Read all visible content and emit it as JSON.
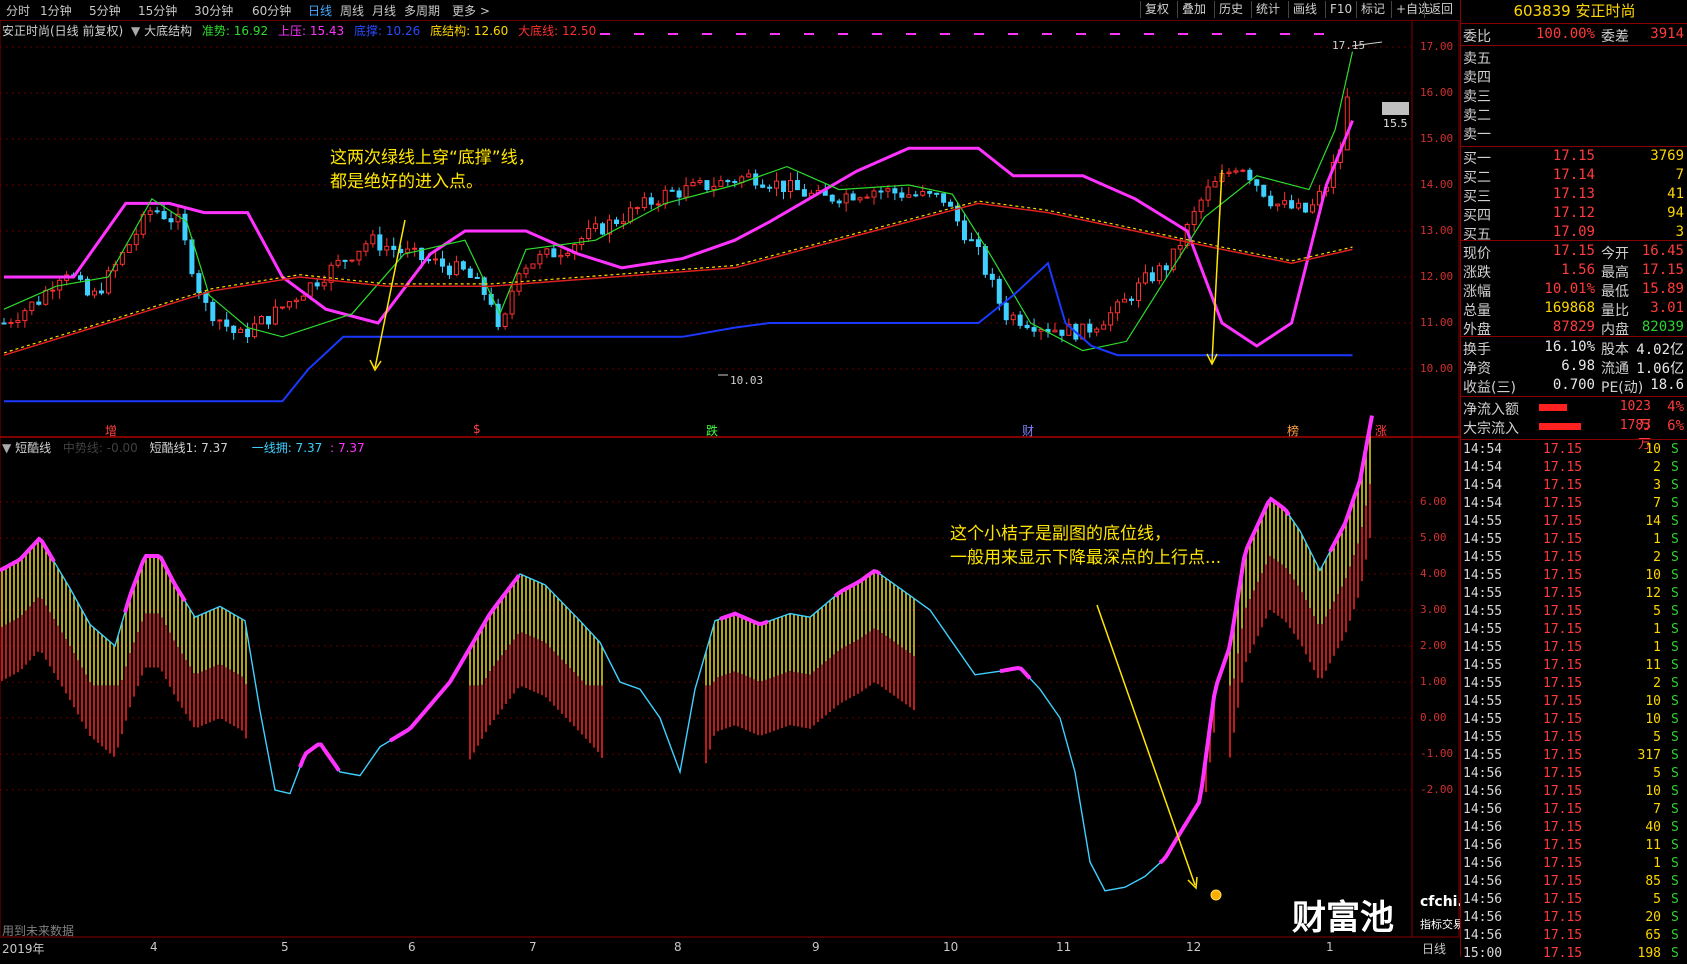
{
  "toolbar": {
    "periods": [
      "分时",
      "1分钟",
      "5分钟",
      "15分钟",
      "30分钟",
      "60分钟",
      "日线",
      "周线",
      "月线",
      "多周期",
      "更多 >"
    ],
    "active_period": "日线",
    "buttons": [
      "复权",
      "叠加",
      "历史",
      "统计",
      "画线",
      "F10",
      "标记",
      "+自选",
      "返回"
    ]
  },
  "main_chart": {
    "title": "安正时尚(日线 前复权)",
    "indicator": "大底结构",
    "legend": [
      {
        "label": "准势: 16.92",
        "color": "#2ddc2d"
      },
      {
        "label": "上压: 15.43",
        "color": "#ff33ff"
      },
      {
        "label": "底撑: 10.26",
        "color": "#2a4bff"
      },
      {
        "label": "底结构: 12.60",
        "color": "#ffd700"
      },
      {
        "label": "大底线: 12.50",
        "color": "#ff3030"
      }
    ],
    "y_ticks": [
      "17.00",
      "16.00",
      "15.00",
      "14.00",
      "13.00",
      "12.00",
      "11.00",
      "10.00"
    ],
    "high_label": "17.15",
    "low_label": "10.03",
    "price_tag": "15.5",
    "markers": [
      {
        "text": "增",
        "color": "#ff4040"
      },
      {
        "text": "$",
        "color": "#ff4040"
      },
      {
        "text": "跌",
        "color": "#40ff40"
      },
      {
        "text": "财",
        "color": "#8080ff"
      },
      {
        "text": "榜",
        "color": "#ffa040"
      },
      {
        "text": "涨",
        "color": "#ff4040"
      }
    ]
  },
  "sub_chart": {
    "title": "短酷线",
    "legend": [
      {
        "label": "中势线: -0.00",
        "color": "#404040"
      },
      {
        "label": "短酷线1: 7.37",
        "color": "#d0d0d0"
      },
      {
        "label": "一线拥: 7.37",
        "color": "#3fd0ff"
      },
      {
        "label": ": 7.37",
        "color": "#ff33ff"
      }
    ],
    "y_ticks": [
      "6.00",
      "5.00",
      "4.00",
      "3.00",
      "2.00",
      "1.00",
      "0.00",
      "-1.00",
      "-2.00"
    ],
    "footer_note": "用到未来数据"
  },
  "annotations": {
    "top": [
      "这两次绿线上穿“底撑”线，",
      "都是绝好的进入点。"
    ],
    "bottom": [
      "这个小桔子是副图的底位线，",
      "一般用来显示下降最深点的上行点..."
    ]
  },
  "x_axis": [
    "2019年",
    "4",
    "5",
    "6",
    "7",
    "8",
    "9",
    "10",
    "11",
    "12",
    "1"
  ],
  "x_axis_right": "日线",
  "watermark": {
    "brand": "财富池",
    "site": "cfchi.com",
    "tagline": "指标交易平台"
  },
  "quote_panel": {
    "code": "603839",
    "name": "安正时尚",
    "weibi_label": "委比",
    "weibi_value": "100.00%",
    "weicha_label": "委差",
    "weicha_value": "3914",
    "asks": [
      {
        "label": "卖五",
        "price": "",
        "vol": ""
      },
      {
        "label": "卖四",
        "price": "",
        "vol": ""
      },
      {
        "label": "卖三",
        "price": "",
        "vol": ""
      },
      {
        "label": "卖二",
        "price": "",
        "vol": ""
      },
      {
        "label": "卖一",
        "price": "",
        "vol": ""
      }
    ],
    "bids": [
      {
        "label": "买一",
        "price": "17.15",
        "vol": "3769"
      },
      {
        "label": "买二",
        "price": "17.14",
        "vol": "7"
      },
      {
        "label": "买三",
        "price": "17.13",
        "vol": "41"
      },
      {
        "label": "买四",
        "price": "17.12",
        "vol": "94"
      },
      {
        "label": "买五",
        "price": "17.09",
        "vol": "3"
      }
    ],
    "stats": [
      {
        "l1": "现价",
        "v1": "17.15",
        "c1": "red",
        "l2": "今开",
        "v2": "16.45",
        "c2": "red"
      },
      {
        "l1": "涨跌",
        "v1": "1.56",
        "c1": "red",
        "l2": "最高",
        "v2": "17.15",
        "c2": "red"
      },
      {
        "l1": "涨幅",
        "v1": "10.01%",
        "c1": "red",
        "l2": "最低",
        "v2": "15.89",
        "c2": "red"
      },
      {
        "l1": "总量",
        "v1": "169868",
        "c1": "yel",
        "l2": "量比",
        "v2": "3.01",
        "c2": "red"
      },
      {
        "l1": "外盘",
        "v1": "87829",
        "c1": "red",
        "l2": "内盘",
        "v2": "82039",
        "c2": "grn"
      }
    ],
    "stats2": [
      {
        "l1": "换手",
        "v1": "16.10%",
        "l2": "股本",
        "v2": "4.02亿"
      },
      {
        "l1": "净资",
        "v1": "6.98",
        "l2": "流通",
        "v2": "1.06亿"
      },
      {
        "l1": "收益(三)",
        "v1": "0.700",
        "l2": "PE(动)",
        "v2": "18.6"
      }
    ],
    "flows": [
      {
        "label": "净流入额",
        "value": "1023万",
        "pct": "4%",
        "bar": 0.4
      },
      {
        "label": "大宗流入",
        "value": "1783万",
        "pct": "6%",
        "bar": 0.6
      }
    ],
    "ticks": [
      [
        "14:54",
        "17.15",
        "10",
        "S"
      ],
      [
        "14:54",
        "17.15",
        "2",
        "S"
      ],
      [
        "14:54",
        "17.15",
        "3",
        "S"
      ],
      [
        "14:54",
        "17.15",
        "7",
        "S"
      ],
      [
        "14:55",
        "17.15",
        "14",
        "S"
      ],
      [
        "14:55",
        "17.15",
        "1",
        "S"
      ],
      [
        "14:55",
        "17.15",
        "2",
        "S"
      ],
      [
        "14:55",
        "17.15",
        "10",
        "S"
      ],
      [
        "14:55",
        "17.15",
        "12",
        "S"
      ],
      [
        "14:55",
        "17.15",
        "5",
        "S"
      ],
      [
        "14:55",
        "17.15",
        "1",
        "S"
      ],
      [
        "14:55",
        "17.15",
        "1",
        "S"
      ],
      [
        "14:55",
        "17.15",
        "11",
        "S"
      ],
      [
        "14:55",
        "17.15",
        "2",
        "S"
      ],
      [
        "14:55",
        "17.15",
        "10",
        "S"
      ],
      [
        "14:55",
        "17.15",
        "10",
        "S"
      ],
      [
        "14:55",
        "17.15",
        "5",
        "S"
      ],
      [
        "14:55",
        "17.15",
        "317",
        "S"
      ],
      [
        "14:56",
        "17.15",
        "5",
        "S"
      ],
      [
        "14:56",
        "17.15",
        "10",
        "S"
      ],
      [
        "14:56",
        "17.15",
        "7",
        "S"
      ],
      [
        "14:56",
        "17.15",
        "40",
        "S"
      ],
      [
        "14:56",
        "17.15",
        "11",
        "S"
      ],
      [
        "14:56",
        "17.15",
        "1",
        "S"
      ],
      [
        "14:56",
        "17.15",
        "85",
        "S"
      ],
      [
        "14:56",
        "17.15",
        "5",
        "S"
      ],
      [
        "14:56",
        "17.15",
        "20",
        "S"
      ],
      [
        "14:56",
        "17.15",
        "65",
        "S"
      ],
      [
        "15:00",
        "17.15",
        "198",
        "S"
      ]
    ]
  }
}
